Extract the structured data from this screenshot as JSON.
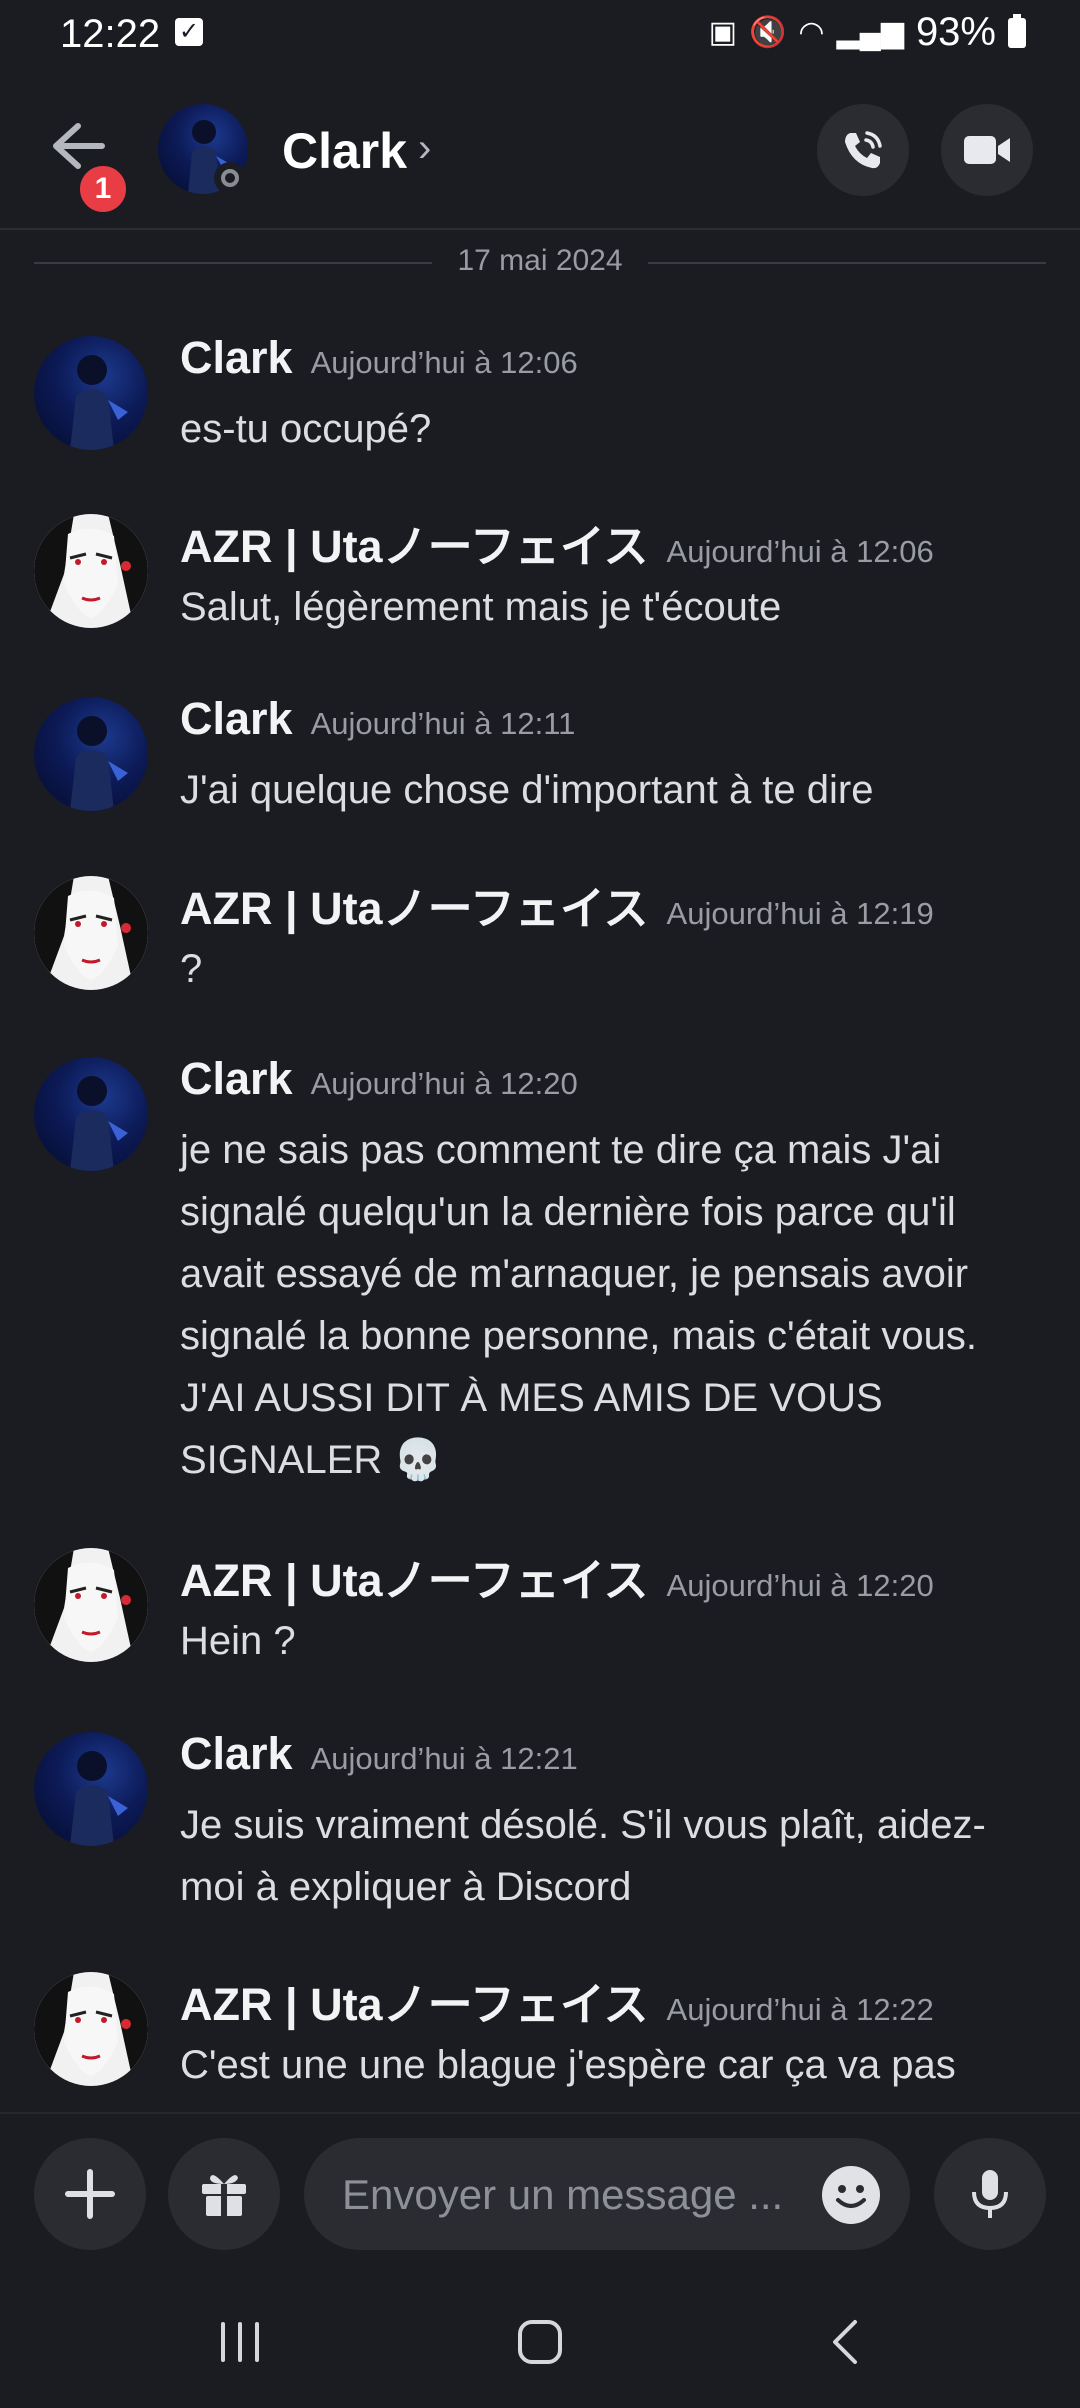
{
  "status": {
    "time": "12:22",
    "battery": "93%"
  },
  "header": {
    "name": "Clark",
    "unread": "1"
  },
  "date_separator": "17 mai 2024",
  "messages": [
    {
      "author": "Clark",
      "time": "Aujourd’hui à 12:06",
      "text": "es-tu occupé?"
    },
    {
      "author": "AZR | Utaノーフェイス",
      "time": "Aujourd’hui à 12:06",
      "text": "Salut, légèrement mais je t'écoute"
    },
    {
      "author": "Clark",
      "time": "Aujourd’hui à 12:11",
      "text": "J'ai quelque chose d'important à te dire"
    },
    {
      "author": "AZR | Utaノーフェイス",
      "time": "Aujourd’hui à 12:19",
      "text": "?"
    },
    {
      "author": "Clark",
      "time": "Aujourd’hui à 12:20",
      "text": "je ne sais pas comment te dire ça mais J'ai signalé quelqu'un la dernière fois parce qu'il avait essayé de m'arnaquer, je pensais avoir signalé la bonne personne, mais c'était vous. J'AI AUSSI DIT À MES AMIS DE VOUS SIGNALER 💀"
    },
    {
      "author": "AZR | Utaノーフェイス",
      "time": "Aujourd’hui à 12:20",
      "text": "Hein ?"
    },
    {
      "author": "Clark",
      "time": "Aujourd’hui à 12:21",
      "text": "Je suis vraiment désolé. S'il vous plaît, aidez-moi à expliquer à Discord"
    },
    {
      "author": "AZR | Utaノーフェイス",
      "time": "Aujourd’hui à 12:22",
      "text": "C'est une une blague j'espère car ça va pas"
    }
  ],
  "composer": {
    "placeholder": "Envoyer un message ..."
  }
}
